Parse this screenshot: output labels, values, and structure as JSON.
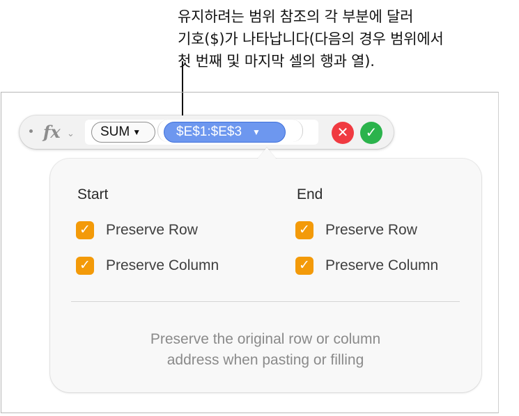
{
  "callout": {
    "lines": [
      "유지하려는 범위 참조의 각 부분에 달러",
      "기호($)가 나타납니다(다음의 경우 범위에서",
      "첫 번째 및 마지막 셀의 행과 열)."
    ]
  },
  "formula_bar": {
    "fx_label": "fx",
    "fx_chevron": "⌄",
    "function_name": "SUM",
    "function_caret": "▼",
    "range_reference": "$E$1:$E$3",
    "range_caret": "▼",
    "cancel_symbol": "✕",
    "accept_symbol": "✓"
  },
  "popover": {
    "start": {
      "heading": "Start",
      "preserve_row": {
        "label": "Preserve Row",
        "checked": true
      },
      "preserve_column": {
        "label": "Preserve Column",
        "checked": true
      }
    },
    "end": {
      "heading": "End",
      "preserve_row": {
        "label": "Preserve Row",
        "checked": true
      },
      "preserve_column": {
        "label": "Preserve Column",
        "checked": true
      }
    },
    "check_glyph": "✓",
    "description_lines": [
      "Preserve the original row or column",
      "address when pasting or filling"
    ]
  },
  "colors": {
    "checkbox_orange": "#f39a09",
    "range_token_blue": "#6d97ef",
    "cancel_red": "#f03a41",
    "accept_green": "#2bb34c"
  }
}
